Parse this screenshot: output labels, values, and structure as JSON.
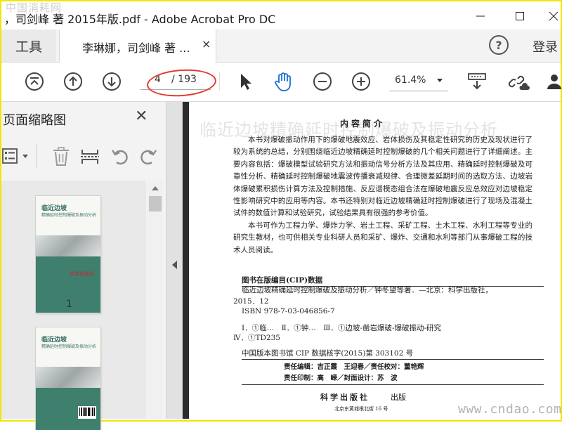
{
  "window": {
    "title": "，司剑峰 著 2015年版.pdf - Adobe Acrobat Pro DC",
    "watermark_top": "中国消耗网"
  },
  "tabs": {
    "tools_label": "工具",
    "doc_label": "李琳娜，司剑峰 著 ...",
    "close_symbol": "×",
    "help_symbol": "?",
    "login_label": "登录"
  },
  "toolbar": {
    "page_current": "4",
    "page_total": "/ 193",
    "zoom": "61.4%"
  },
  "sidebar": {
    "title": "页面缩略图",
    "close_symbol": "✕",
    "thumbnails": [
      {
        "page_label": "1",
        "title": "临近边坡",
        "subtitle": "精确延时控制爆破及振动分析",
        "publisher": "科学出版社"
      },
      {
        "page_label": "",
        "title": "临近边坡",
        "subtitle": "精确延时控制爆破及振动分析",
        "publisher": ""
      }
    ]
  },
  "document": {
    "ghost_title": "临近边坡精确延时控制爆破及振动分析",
    "section_heading": "内容简介",
    "paragraph1": "本书对爆破振动作用下的爆破地震效应、岩体损伤及其稳定性研究的历史及现状进行了较为系统的总结，分别围绕临近边坡精确延时控制爆破的几个相关问题进行了详细阐述。主要内容包括：爆破模型试验研究方法和振动信号分析方法及其应用、精确延时控制爆破及可靠性分析、精确延时控制爆破地震波传播衰减规律、合理微差延期时间的选取方法、边坡岩体爆破累积损伤计算方法及控制措施、反应谱模态组合法在爆破地震反应总效应对边坡稳定性影响研究中的应用等内容。本书还特别对临近边坡精确延时控制爆破进行了现场及混凝土试件的数值计算和试验研究，试验结果具有很强的参考价值。",
    "paragraph2": "本书可作为工程力学、爆炸力学、岩土工程、采矿工程、土木工程、水利工程等专业的研究生教材，也可供相关专业科研人员和采矿、爆炸、交通和水利等部门从事爆破工程的技术人员阅读。",
    "cip_heading": "图书在版编目(CIP)数据",
    "cip_line1": "临近边坡精确延时控制爆破及振动分析／钟冬望等著．—北京：科学出版社，",
    "cip_line2": "2015．12",
    "cip_line3": "ISBN 978-7-03-046856-7",
    "cip_line4": "Ⅰ．①临…　Ⅱ．①钟…　Ⅲ．①边坡-凿岩爆破-爆破振动-研究",
    "cip_line5": "Ⅳ．①TD235",
    "cip_number": "中国版本图书馆 CIP 数据核字(2015)第 303102 号",
    "editor_line": "责任编辑：吉正霞　王迎春／责任校对：董艳辉",
    "print_line": "责任印制：高　嵘／封面设计：苏　波",
    "publisher": "科学出版社",
    "publisher_suffix": "出版",
    "address": "北京东黄城根北街 16 号"
  },
  "watermark_bottom": "www.cndao.com"
}
